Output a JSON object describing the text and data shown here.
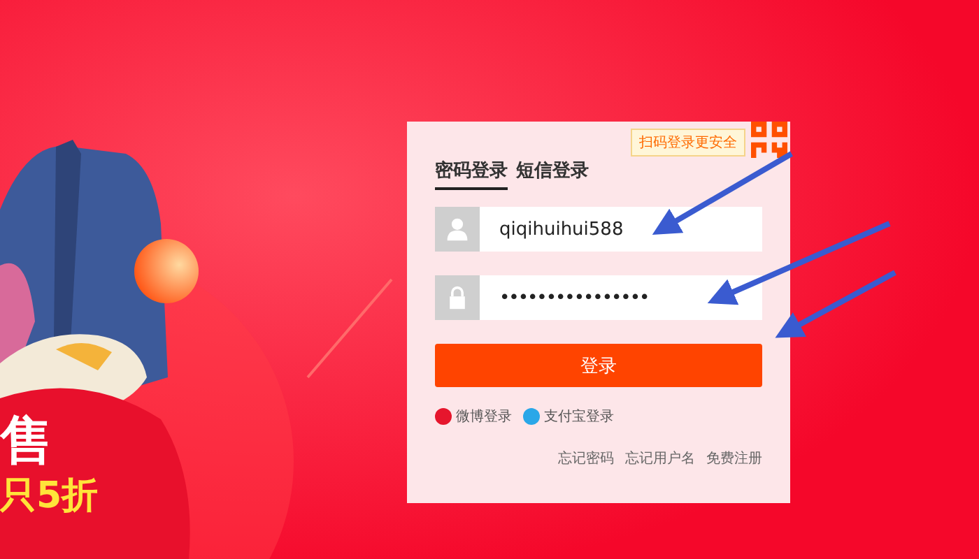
{
  "banner": {
    "headline": "售",
    "subline": "只5折"
  },
  "login": {
    "qr_tip": "扫码登录更安全",
    "tabs": [
      {
        "label": "密码登录",
        "selected": true
      },
      {
        "label": "短信登录",
        "selected": false
      }
    ],
    "username": {
      "value": "qiqihuihui588"
    },
    "password": {
      "value": "••••••••••••••••"
    },
    "submit": "登录",
    "social": [
      {
        "label": "微博登录",
        "kind": "weibo"
      },
      {
        "label": "支付宝登录",
        "kind": "alipay"
      }
    ],
    "links": [
      "忘记密码",
      "忘记用户名",
      "免费注册"
    ]
  }
}
